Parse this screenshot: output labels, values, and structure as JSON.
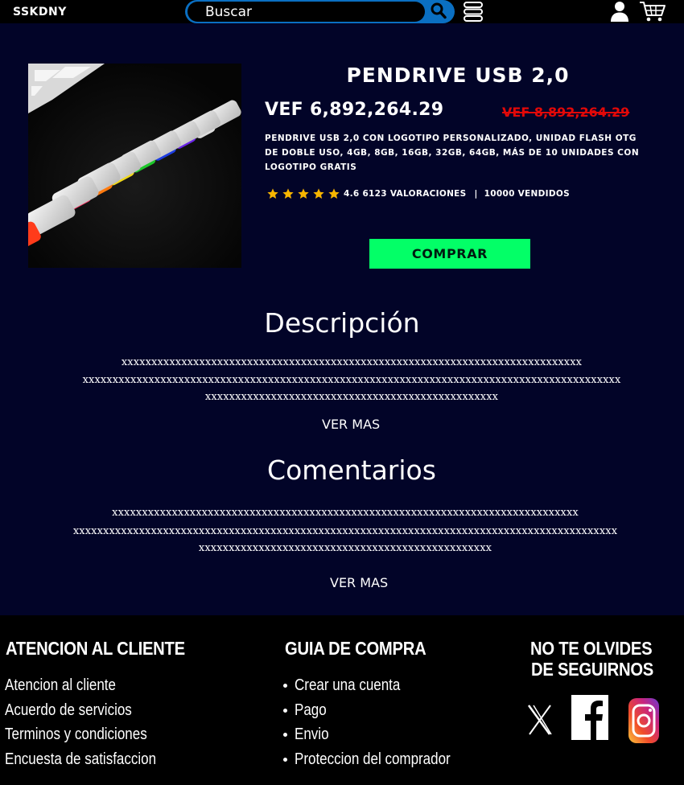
{
  "header": {
    "brand": "SSKDNY",
    "search_placeholder": "Buscar",
    "icons": [
      "search-icon",
      "menu-icon",
      "user-icon",
      "cart-icon"
    ]
  },
  "product": {
    "title": "PENDRIVE USB 2,0",
    "price": "VEF 6,892,264.29",
    "old_price": "VEF 8,892,264.29",
    "short_description": "PENDRIVE USB 2,0 CON LOGOTIPO PERSONALIZADO, UNIDAD FLASH OTG DE DOBLE USO, 4GB, 8GB, 16GB, 32GB, 64GB, MÁS DE 10 UNIDADES CON LOGOTIPO GRATIS",
    "rating": 4.6,
    "star_count": 5,
    "rating_text": "4.6 6123 VALORACIONES",
    "sold_text": "10000 VENDIDOS",
    "buy_label": "COMPRAR"
  },
  "description": {
    "title": "Descripción",
    "lines": [
      "xxxxxxxxxxxxxxxxxxxxxxxxxxxxxxxxxxxxxxxxxxxxxxxxxxxxxxxxxxxxxxxxxxxxxxxxxxxxx",
      "xxxxxxxxxxxxxxxxxxxxxxxxxxxxxxxxxxxxxxxxxxxxxxxxxxxxxxxxxxxxxxxxxxxxxxxxxxxxxxxxxxxxxxxxxx",
      "xxxxxxxxxxxxxxxxxxxxxxxxxxxxxxxxxxxxxxxxxxxxxxxxx"
    ],
    "more_label": "VER MAS"
  },
  "comments": {
    "title": "Comentarios",
    "lines": [
      "xxxxxxxxxxxxxxxxxxxxxxxxxxxxxxxxxxxxxxxxxxxxxxxxxxxxxxxxxxxxxxxxxxxxxxxxxxxxxx",
      "xxxxxxxxxxxxxxxxxxxxxxxxxxxxxxxxxxxxxxxxxxxxxxxxxxxxxxxxxxxxxxxxxxxxxxxxxxxxxxxxxxxxxxxxxxx",
      "xxxxxxxxxxxxxxxxxxxxxxxxxxxxxxxxxxxxxxxxxxxxxxxxx"
    ],
    "more_label": "VER MAS"
  },
  "footer": {
    "customer_service": {
      "title": "ATENCION AL CLIENTE",
      "links": [
        "Atencion al cliente",
        "Acuerdo de servicios",
        "Terminos y condiciones",
        "Encuesta de satisfaccion"
      ]
    },
    "purchase_guide": {
      "title": "GUIA DE COMPRA",
      "links": [
        "Crear una cuenta",
        "Pago",
        "Envio",
        "Proteccion del comprador"
      ]
    },
    "follow": {
      "title_line1": "NO TE OLVIDES",
      "title_line2": "DE SEGUIRNOS",
      "icons": [
        "x-icon",
        "facebook-icon",
        "instagram-icon"
      ]
    }
  },
  "colors": {
    "main_bg": "#020428",
    "header_bg": "#000000",
    "search_border": "#0a6fc2",
    "buy_button": "#03ff67",
    "old_price": "#e20808",
    "star": "#f7b500"
  }
}
